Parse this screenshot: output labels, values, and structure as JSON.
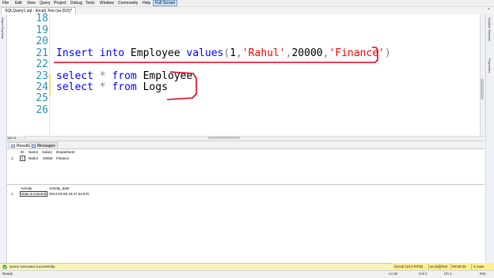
{
  "menu": {
    "items": [
      "File",
      "Edit",
      "View",
      "Query",
      "Project",
      "Debug",
      "Tools",
      "Window",
      "Community",
      "Help"
    ],
    "active": "Full Screen"
  },
  "document_tab": {
    "title": "SQLQuery1.sql - (local).Test (sa (52))*",
    "close_glyph": "×"
  },
  "side_panels": {
    "left": "Object Explorer",
    "right_top": "Solution Explorer",
    "right_bottom": "Properties"
  },
  "editor": {
    "zoom": "100 %",
    "lines": [
      {
        "number": "18",
        "tokens": []
      },
      {
        "number": "19",
        "tokens": []
      },
      {
        "number": "20",
        "tokens": []
      },
      {
        "number": "21",
        "tokens": [
          {
            "t": "Insert",
            "k": "kw"
          },
          {
            "t": " ",
            "k": "plain"
          },
          {
            "t": "into",
            "k": "kw"
          },
          {
            "t": " Employee ",
            "k": "plain"
          },
          {
            "t": "values",
            "k": "kw"
          },
          {
            "t": "(",
            "k": "punct"
          },
          {
            "t": "1",
            "k": "plain"
          },
          {
            "t": ",",
            "k": "punct"
          },
          {
            "t": "'Rahul'",
            "k": "str"
          },
          {
            "t": ",",
            "k": "punct"
          },
          {
            "t": "20000",
            "k": "plain"
          },
          {
            "t": ",",
            "k": "punct"
          },
          {
            "t": "'Finance'",
            "k": "str"
          },
          {
            "t": ")",
            "k": "punct"
          }
        ]
      },
      {
        "number": "22",
        "tokens": []
      },
      {
        "number": "23",
        "tokens": [
          {
            "t": "select",
            "k": "kw"
          },
          {
            "t": " ",
            "k": "plain"
          },
          {
            "t": "*",
            "k": "punct"
          },
          {
            "t": " ",
            "k": "plain"
          },
          {
            "t": "from",
            "k": "kw"
          },
          {
            "t": " Employee",
            "k": "plain"
          }
        ]
      },
      {
        "number": "24",
        "tokens": [
          {
            "t": "select",
            "k": "kw"
          },
          {
            "t": " ",
            "k": "plain"
          },
          {
            "t": "*",
            "k": "punct"
          },
          {
            "t": " ",
            "k": "plain"
          },
          {
            "t": "from",
            "k": "kw"
          },
          {
            "t": " Logs",
            "k": "plain"
          }
        ]
      },
      {
        "number": "25",
        "tokens": []
      },
      {
        "number": "26",
        "tokens": []
      }
    ]
  },
  "results_tabs": [
    {
      "label": "Results",
      "active": true
    },
    {
      "label": "Messages",
      "active": false
    }
  ],
  "grid1": {
    "columns": [
      "ID",
      "Name",
      "Salary",
      "Department"
    ],
    "rows": [
      {
        "rownum": "1",
        "cells": [
          "1",
          "Rahul",
          "20000",
          "Finance"
        ]
      }
    ]
  },
  "grid2": {
    "columns": [
      "Activity",
      "Activity_date"
    ],
    "rows": [
      {
        "rownum": "1",
        "cells": [
          "Data is inserted",
          "2014-03-08 10:47:24.870"
        ]
      }
    ]
  },
  "query_status": {
    "message": "Query executed successfully.",
    "server": "(local) (10.0 RTM)",
    "login": "sa (52)",
    "database": "Test",
    "elapsed": "00:00:00",
    "rows": "2 rows"
  },
  "app_status": {
    "state": "Ready",
    "line": "Ln 22",
    "col": "Col 1",
    "ch": "Ch 1",
    "mode": "INS"
  },
  "colors": {
    "keyword": "#0000ff",
    "string": "#ff0000",
    "line_number": "#2b91af",
    "annotation": "#e0001b",
    "status_bar": "#fbf4b9"
  }
}
